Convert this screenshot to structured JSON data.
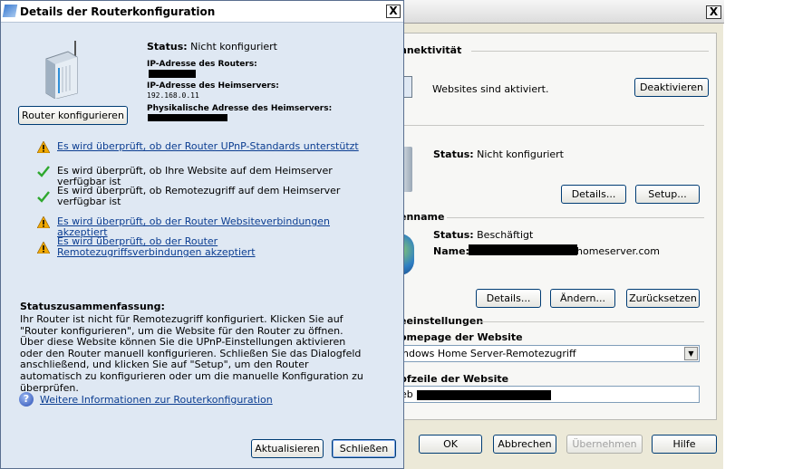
{
  "dialog": {
    "title": "Details der Routerkonfiguration",
    "close_glyph": "X",
    "configure_button": "Router konfigurieren",
    "status_label": "Status:",
    "status_value": "Nicht konfiguriert",
    "router_ip_label": "IP-Adresse des Routers:",
    "server_ip_label": "IP-Adresse des Heimservers:",
    "server_ip_value": "192.168.0.11",
    "mac_label": "Physikalische Adresse des Heimservers:",
    "checks": [
      {
        "text": "Es wird überprüft, ob der Router UPnP-Standards unterstützt",
        "status": "warning"
      },
      {
        "text": "Es wird überprüft, ob Ihre Website auf dem Heimserver verfügbar ist",
        "status": "ok"
      },
      {
        "text": "Es wird überprüft, ob Remotezugriff auf dem Heimserver verfügbar ist",
        "status": "ok"
      },
      {
        "text": "Es wird überprüft, ob der Router Websiteverbindungen akzeptiert",
        "status": "warning"
      },
      {
        "text": "Es wird überprüft, ob der Router Remotezugriffsverbindungen akzeptiert",
        "status": "warning"
      }
    ],
    "summary_title": "Statuszusammenfassung:",
    "summary_text": "Ihr Router ist nicht für Remotezugriff konfiguriert. Klicken Sie auf \"Router konfigurieren\", um die Website für den Router zu öffnen. Über diese Website können Sie die UPnP-Einstellungen aktivieren oder den Router manuell konfigurieren. Schließen Sie das Dialogfeld anschließend, und klicken Sie auf \"Setup\", um den Router automatisch zu konfigurieren oder um die manuelle Konfiguration zu überprüfen.",
    "info_link": "Weitere Informationen zur Routerkonfiguration",
    "refresh_button": "Aktualisieren",
    "close_button": "Schließen"
  },
  "background": {
    "close_glyph": "X",
    "connectivity_title": "nnektivität",
    "websites_status": "Websites sind aktiviert.",
    "deactivate_button": "Deaktivieren",
    "router_status_label": "Status:",
    "router_status_value": "Nicht konfiguriert",
    "details_button": "Details...",
    "setup_button": "Setup...",
    "domain_title": "enname",
    "domain_status_label": "Status:",
    "domain_status_value": "Beschäftigt",
    "domain_name_label": "Name:",
    "domain_name_suffix": "homeserver.com",
    "details_button2": "Details...",
    "change_button": "Ändern...",
    "reset_button": "Zurücksetzen",
    "settings_title": "eeinstellungen",
    "homepage_label": "omepage der Website",
    "homepage_value": "ndows Home Server-Remotezugriff",
    "header_label": "pfzeile der Website",
    "header_value_prefix": "eb",
    "ok_button": "OK",
    "cancel_button": "Abbrechen",
    "apply_button": "Übernehmen",
    "help_button": "Hilfe"
  },
  "colors": {
    "dialog_bg": "#dfe8f3",
    "link": "#0b3d91",
    "warning": "#f0a800",
    "ok": "#2ea82e"
  }
}
